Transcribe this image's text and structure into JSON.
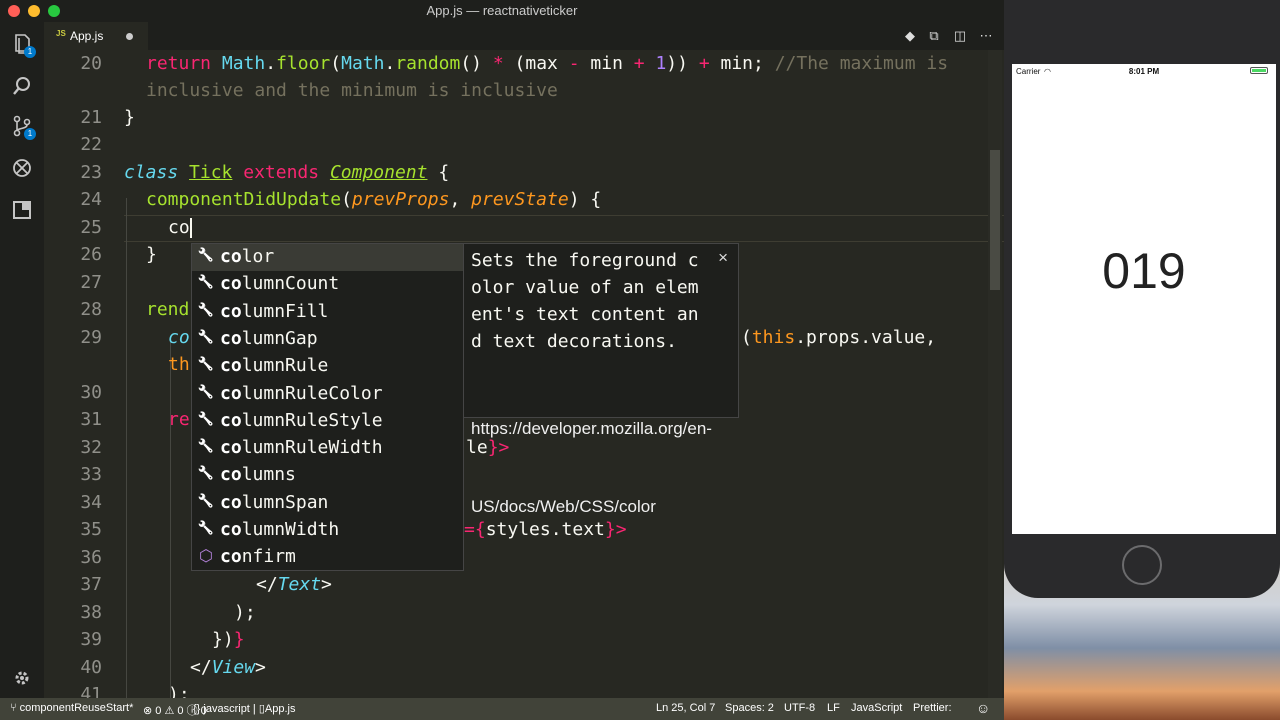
{
  "window": {
    "title": "App.js — reactnativeticker"
  },
  "tab": {
    "lang_badge": "JS",
    "label": "App.js"
  },
  "activity": {
    "explorer_badge": "1",
    "scm_badge": "1"
  },
  "editor": {
    "lines": [
      {
        "num": "20",
        "wrap": ""
      },
      {
        "num": "21"
      },
      {
        "num": "22"
      },
      {
        "num": "23"
      },
      {
        "num": "24"
      },
      {
        "num": "25"
      },
      {
        "num": "26"
      },
      {
        "num": "27"
      },
      {
        "num": "28"
      },
      {
        "num": "29"
      },
      {
        "num": "30"
      },
      {
        "num": "31"
      },
      {
        "num": "32"
      },
      {
        "num": "33"
      },
      {
        "num": "34"
      },
      {
        "num": "35"
      },
      {
        "num": "36"
      },
      {
        "num": "37"
      },
      {
        "num": "38"
      },
      {
        "num": "39"
      },
      {
        "num": "40"
      },
      {
        "num": "41"
      }
    ],
    "code": {
      "l20_a": "return",
      "l20_b": "Math",
      "l20_c": "floor",
      "l20_d": "Math",
      "l20_e": "random",
      "l20_rest1": "() ",
      "l20_op1": "*",
      "l20_rest2": " (max ",
      "l20_op2": "-",
      "l20_rest3": " min ",
      "l20_op3": "+",
      "l20_num": "1",
      "l20_rest4": ")) ",
      "l20_op4": "+",
      "l20_rest5": " min; ",
      "l20_comment1": "//The maximum is",
      "l20_comment2": "inclusive and the minimum is inclusive",
      "l21": "}",
      "l23_class": "class",
      "l23_name": "Tick",
      "l23_extends": "extends",
      "l23_base": "Component",
      "l23_brace": " {",
      "l24_fn": "componentDidUpdate",
      "l24_p1": "prevProps",
      "l24_p2": "prevState",
      "l24_end": ") {",
      "l25": "co",
      "l26": "}",
      "l28": "rend",
      "l29_a": "co",
      "l29_tail_kw": "this",
      "l29_tail": ".props.value,",
      "l29b": "th",
      "l31": "re",
      "l32_tail": "le",
      "l32_end": "}>",
      "l35_a": "={",
      "l35_b": "styles.text",
      "l35_c": "}>",
      "l37_a": "</",
      "l37_b": "Text",
      "l37_c": ">",
      "l38": ");",
      "l39_a": "})",
      "l39_b": "}",
      "l40_a": "</",
      "l40_b": "View",
      "l40_c": ">",
      "l41": ");"
    }
  },
  "suggest": {
    "items": [
      {
        "match": "co",
        "rest": "lor",
        "icon": "wrench-icon"
      },
      {
        "match": "co",
        "rest": "lumnCount",
        "icon": "wrench-icon"
      },
      {
        "match": "co",
        "rest": "lumnFill",
        "icon": "wrench-icon"
      },
      {
        "match": "co",
        "rest": "lumnGap",
        "icon": "wrench-icon"
      },
      {
        "match": "co",
        "rest": "lumnRule",
        "icon": "wrench-icon"
      },
      {
        "match": "co",
        "rest": "lumnRuleColor",
        "icon": "wrench-icon"
      },
      {
        "match": "co",
        "rest": "lumnRuleStyle",
        "icon": "wrench-icon"
      },
      {
        "match": "co",
        "rest": "lumnRuleWidth",
        "icon": "wrench-icon"
      },
      {
        "match": "co",
        "rest": "lumns",
        "icon": "wrench-icon"
      },
      {
        "match": "co",
        "rest": "lumnSpan",
        "icon": "wrench-icon"
      },
      {
        "match": "co",
        "rest": "lumnWidth",
        "icon": "wrench-icon"
      },
      {
        "match": "co",
        "rest": "nfirm",
        "icon": "cube-icon"
      }
    ],
    "docs": {
      "desc_lines": [
        "Sets the foreground c",
        "olor value of an elem",
        "ent's text content an",
        "d text decorations."
      ],
      "url_lines": [
        "https://developer.mozilla.org/en-",
        "US/docs/Web/CSS/color"
      ],
      "close": "×"
    }
  },
  "status": {
    "branch": "componentReuseStart*",
    "errors": "0",
    "warnings": "0",
    "infos": "0",
    "lang_path": "javascript",
    "file": "App.js",
    "position": "Ln 25, Col 7",
    "spaces": "Spaces: 2",
    "encoding": "UTF-8",
    "eol": "LF",
    "language": "JavaScript",
    "prettier": "Prettier:"
  },
  "simulator": {
    "carrier": "Carrier",
    "time": "8:01 PM",
    "counter": "019"
  },
  "colors": {
    "background": "#272822",
    "keyword": "#f92672",
    "function": "#a6e22e",
    "class": "#66d9ef",
    "param": "#fd971f",
    "number": "#ae81ff",
    "comment": "#75715e",
    "statusbar": "#414339"
  }
}
